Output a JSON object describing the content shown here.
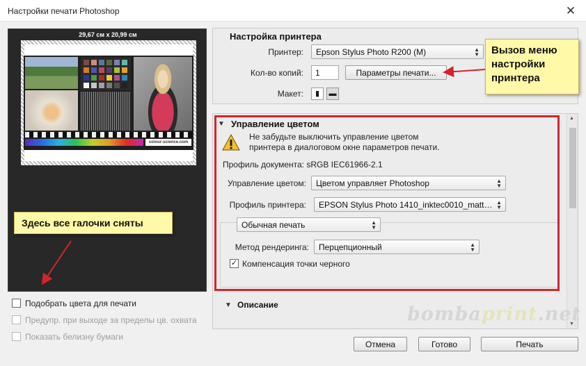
{
  "window": {
    "title": "Настройки печати Photoshop",
    "close_glyph": "✕"
  },
  "preview": {
    "paper_size": "29,67 см x 20,99 см",
    "credit": "colour-science.com"
  },
  "printer_setup": {
    "title": "Настройка принтера",
    "printer_label": "Принтер:",
    "printer_value": "Epson Stylus Photo R200 (M)",
    "copies_label": "Кол-во копий:",
    "copies_value": "1",
    "print_settings_button": "Параметры печати...",
    "layout_label": "Макет:"
  },
  "color_management": {
    "title": "Управление цветом",
    "warning": "Не забудьте выключить управление цветом\nпринтера в диалоговом окне параметров печати.",
    "doc_profile_label": "Профиль документа: sRGB IEC61966-2.1",
    "cm_label": "Управление цветом:",
    "cm_value": "Цветом управляет Photoshop",
    "printer_profile_label": "Профиль принтера:",
    "printer_profile_value": "EPSON Stylus Photo 1410_inktec0010_matt…",
    "print_mode_value": "Обычная печать",
    "render_label": "Метод рендеринга:",
    "render_value": "Перцепционный",
    "bpc_label": "Компенсация точки черного",
    "bpc_checked": true
  },
  "description": {
    "title": "Описание"
  },
  "left_options": [
    {
      "label": "Подобрать цвета для печати",
      "checked": false,
      "disabled": false
    },
    {
      "label": "Предупр. при выходе за пределы цв. охвата",
      "checked": false,
      "disabled": true
    },
    {
      "label": "Показать белизну бумаги",
      "checked": false,
      "disabled": true
    }
  ],
  "annotations": {
    "printer_menu_note": "Вызов меню\nнастройки\nпринтера",
    "checkboxes_note": "Здесь все галочки сняты"
  },
  "watermark": {
    "part1": "bomba",
    "part2": "print",
    "part3": ".net"
  },
  "footer": {
    "cancel": "Отмена",
    "done": "Готово",
    "print": "Печать"
  },
  "colors": {
    "accent_red": "#d6232b",
    "note_yellow": "#fff9a8"
  }
}
